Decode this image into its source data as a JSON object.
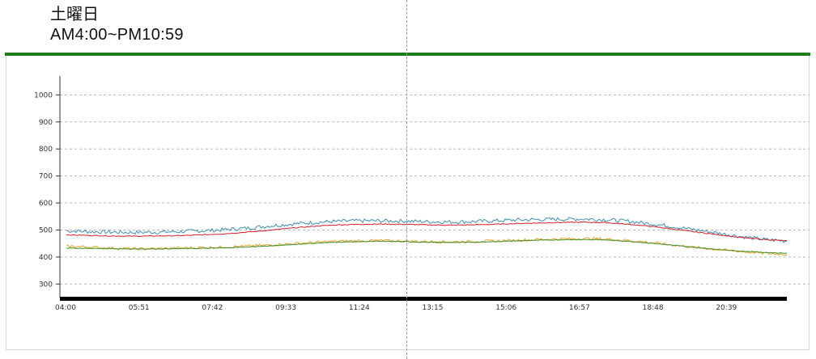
{
  "header": {
    "day": "土曜日",
    "time_range": "AM4:00~PM10:59"
  },
  "colors": {
    "blue": "#3f8fb0",
    "red": "#d81f2a",
    "orange": "#e8a020",
    "green": "#3f8f2f",
    "top_bar": "#1a7f1a"
  },
  "chart_data": {
    "type": "line",
    "x_tick_labels": [
      "04:00",
      "05:51",
      "07:42",
      "09:33",
      "11:24",
      "13:15",
      "15:06",
      "16:57",
      "18:48",
      "20:39"
    ],
    "y_ticks": [
      300,
      400,
      500,
      600,
      700,
      800,
      900,
      1000
    ],
    "ylim": [
      250,
      1070
    ],
    "grid": true,
    "series": [
      {
        "color": "blue",
        "values": [
          497,
          494,
          492,
          491,
          492,
          494,
          497,
          501,
          507,
          515,
          522,
          528,
          532,
          534,
          534,
          533,
          531,
          530,
          531,
          534,
          537,
          539,
          540,
          541,
          538,
          532,
          523,
          512,
          500,
          488,
          475,
          465,
          459
        ]
      },
      {
        "color": "red",
        "values": [
          482,
          480,
          478,
          477,
          478,
          479,
          482,
          486,
          492,
          499,
          507,
          514,
          519,
          521,
          522,
          521,
          519,
          518,
          519,
          521,
          524,
          526,
          528,
          529,
          527,
          521,
          513,
          503,
          492,
          482,
          472,
          465,
          460
        ]
      },
      {
        "color": "orange",
        "values": [
          440,
          437,
          433,
          430,
          431,
          433,
          435,
          437,
          440,
          444,
          449,
          454,
          458,
          460,
          461,
          459,
          457,
          456,
          457,
          459,
          462,
          465,
          467,
          468,
          466,
          461,
          453,
          444,
          435,
          427,
          420,
          414,
          410
        ]
      },
      {
        "color": "green",
        "values": [
          433,
          432,
          431,
          430,
          430,
          431,
          432,
          434,
          437,
          441,
          446,
          451,
          455,
          457,
          458,
          457,
          455,
          454,
          455,
          457,
          460,
          462,
          464,
          465,
          463,
          458,
          451,
          443,
          435,
          428,
          422,
          417,
          414
        ]
      }
    ]
  }
}
